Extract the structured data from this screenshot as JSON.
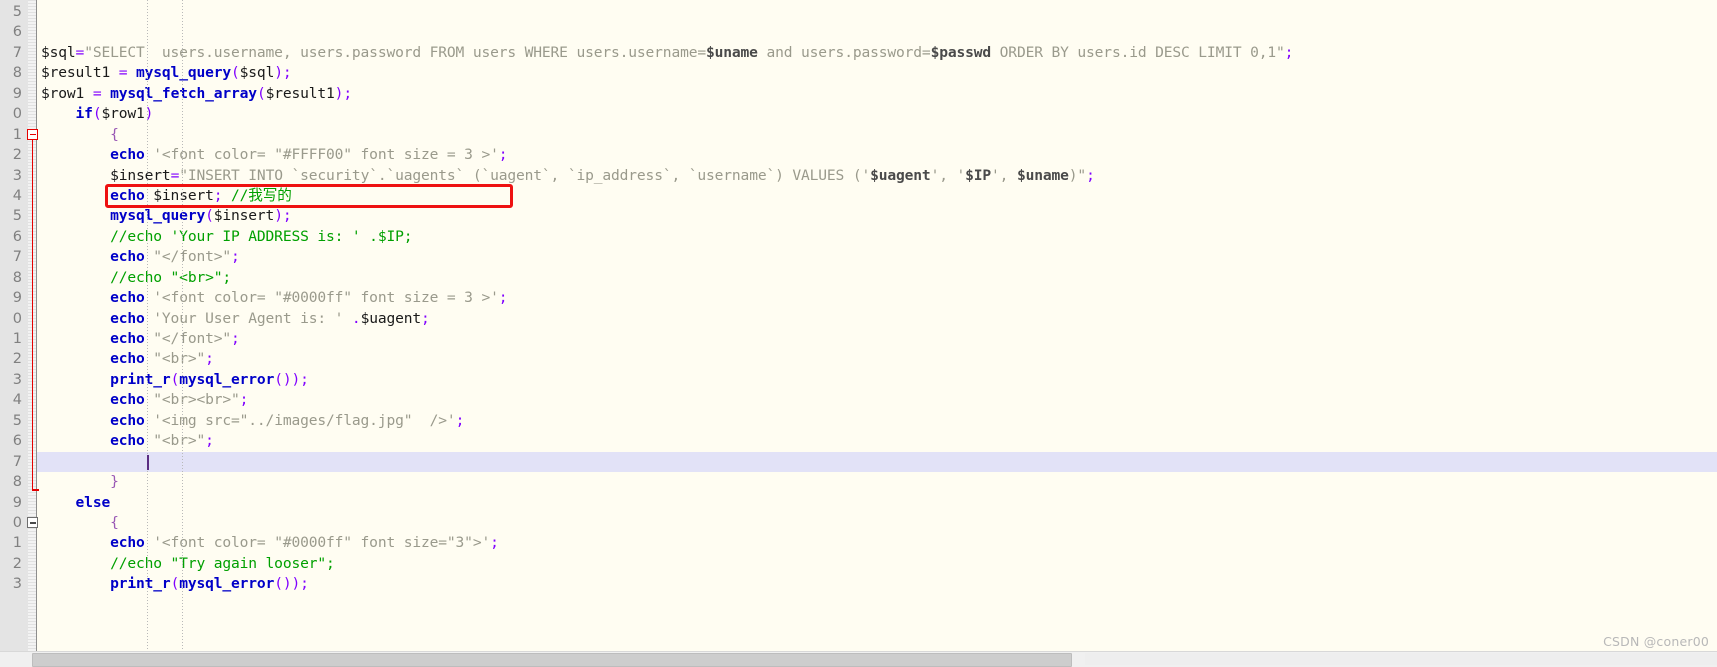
{
  "editor": {
    "name": "php-source-editor",
    "background_color": "#fffdf2",
    "gutter_color": "#e4e4e4",
    "current_line_color": "#e2e2f7",
    "annotation_color": "#ee1111",
    "comment_color": "#00a000",
    "keyword_color": "#0000c8",
    "string_color": "#9a9a8c",
    "operator_color": "#8000ff"
  },
  "line_numbers": [
    "5",
    "6",
    "7",
    "8",
    "9",
    "0",
    "1",
    "2",
    "3",
    "4",
    "5",
    "6",
    "7",
    "8",
    "9",
    "0",
    "1",
    "2",
    "3",
    "4",
    "5",
    "6",
    "7",
    "8",
    "9",
    "0",
    "1",
    "2",
    "3"
  ],
  "code_lines": [
    {
      "n": 0,
      "text": ""
    },
    {
      "n": 1,
      "text": ""
    },
    {
      "n": 2,
      "text": "$sql=\"SELECT  users.username, users.password FROM users WHERE users.username=$uname and users.password=$passwd ORDER BY users.id DESC LIMIT 0,1\";"
    },
    {
      "n": 3,
      "text": "$result1 = mysql_query($sql);"
    },
    {
      "n": 4,
      "text": "$row1 = mysql_fetch_array($result1);"
    },
    {
      "n": 5,
      "text": "    if($row1)"
    },
    {
      "n": 6,
      "text": "        {"
    },
    {
      "n": 7,
      "text": "        echo '<font color= \"#FFFF00\" font size = 3 >';"
    },
    {
      "n": 8,
      "text": "        $insert=\"INSERT INTO `security`.`uagents` (`uagent`, `ip_address`, `username`) VALUES ('$uagent', '$IP', $uname)\";"
    },
    {
      "n": 9,
      "text": "        echo $insert; //我写的"
    },
    {
      "n": 10,
      "text": "        mysql_query($insert);"
    },
    {
      "n": 11,
      "text": "        //echo 'Your IP ADDRESS is: ' .$IP;"
    },
    {
      "n": 12,
      "text": "        echo \"</font>\";"
    },
    {
      "n": 13,
      "text": "        //echo \"<br>\";"
    },
    {
      "n": 14,
      "text": "        echo '<font color= \"#0000ff\" font size = 3 >';"
    },
    {
      "n": 15,
      "text": "        echo 'Your User Agent is: ' .$uagent;"
    },
    {
      "n": 16,
      "text": "        echo \"</font>\";"
    },
    {
      "n": 17,
      "text": "        echo \"<br>\";"
    },
    {
      "n": 18,
      "text": "        print_r(mysql_error());"
    },
    {
      "n": 19,
      "text": "        echo \"<br><br>\";"
    },
    {
      "n": 20,
      "text": "        echo '<img src=\"../images/flag.jpg\"  />';"
    },
    {
      "n": 21,
      "text": "        echo \"<br>\";"
    },
    {
      "n": 22,
      "text": "        "
    },
    {
      "n": 23,
      "text": "        }"
    },
    {
      "n": 24,
      "text": "    else"
    },
    {
      "n": 25,
      "text": "        {"
    },
    {
      "n": 26,
      "text": "        echo '<font color= \"#0000ff\" font size=\"3\">';"
    },
    {
      "n": 27,
      "text": "        //echo \"Try again looser\";"
    },
    {
      "n": 28,
      "text": "        print_r(mysql_error());"
    }
  ],
  "annotation": {
    "label": "red-highlight-box",
    "target_line_text": "echo $insert; //我写的"
  },
  "fold_markers": [
    {
      "label": "fold-open-if-block",
      "style": "red"
    },
    {
      "label": "fold-open-else-block",
      "style": "gray"
    }
  ],
  "current_line": {
    "number_label": "7",
    "content": ""
  },
  "watermark": {
    "text": "CSDN @coner00"
  },
  "scrollbar": {
    "orientation": "horizontal"
  }
}
